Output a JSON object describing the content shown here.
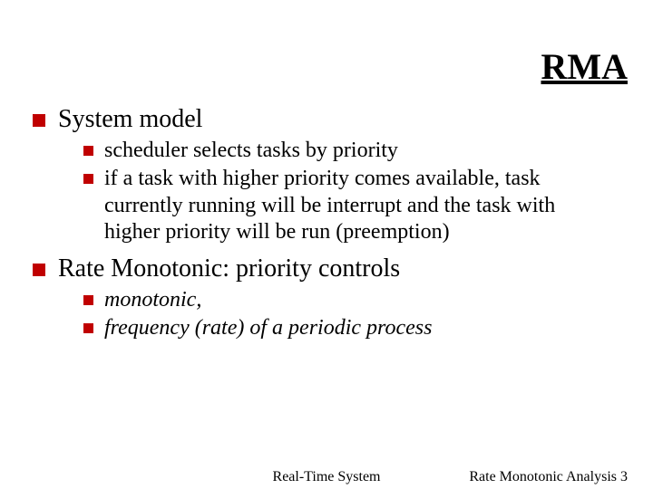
{
  "title": "RMA",
  "bullets": [
    {
      "text": "System model",
      "children": [
        {
          "text": "scheduler selects tasks by priority",
          "italic": false
        },
        {
          "text": "if a task with higher priority comes available, task currently running will be interrupt and the task with higher priority will be run (preemption)",
          "italic": false
        }
      ]
    },
    {
      "text": "Rate Monotonic: priority controls",
      "children": [
        {
          "text": "monotonic,",
          "italic": true
        },
        {
          "text": "frequency (rate) of a periodic process",
          "italic": true
        }
      ]
    }
  ],
  "footer": {
    "center": "Real-Time System",
    "right_label": "Rate Monotonic Analysis",
    "right_num": "3"
  }
}
